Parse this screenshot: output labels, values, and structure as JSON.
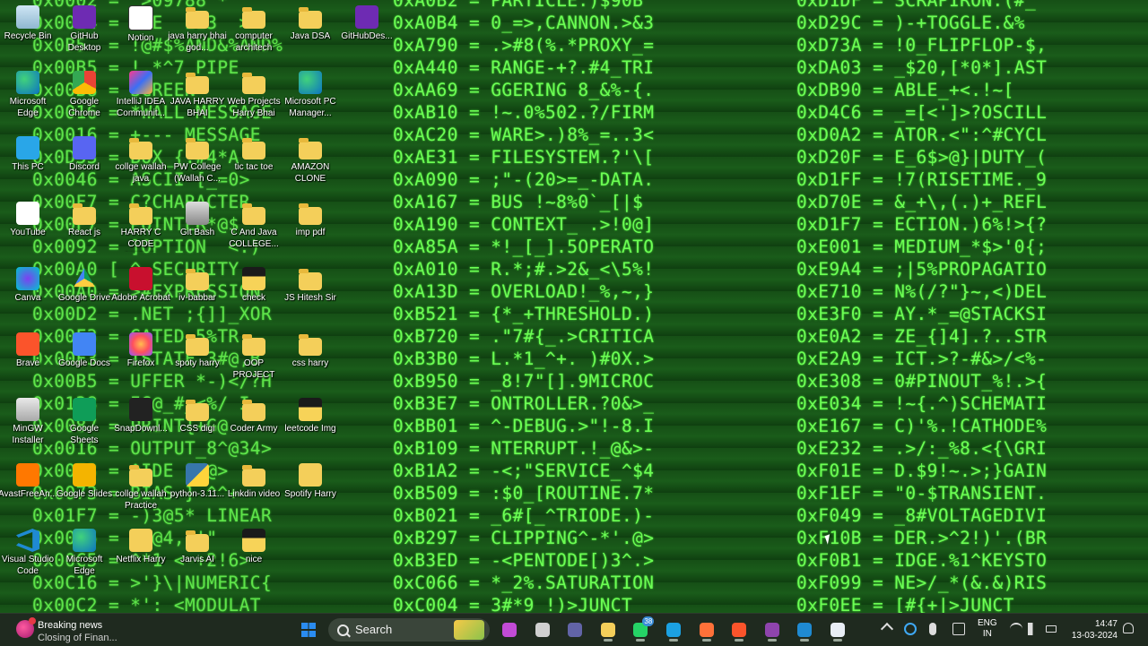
{
  "wallpaper": {
    "col_a": [
      "0x0002 = _>09788 *",
      "0x0024 = USE  LE3  >",
      "0x0B5  = !@#$%AND&%AND%",
      "0x00B5 = !.*^7 PIPE",
      "0x00B8 = SCREEN",
      "0x0016 = *WALL MESSAGE",
      "0x0016 = +--- MESSAGE",
      "0x0D33 = BOX_{.#4*A",
      "0x0046 = ASCII [_=0>",
      "0x00F7 = C?CHARACTER",
      "0x00F7 = POINTER*@$",
      "0x0092 = ]OPTION  <.)",
      "0x00A0 [ ^ SECURITY",
      "0x00A0 = >#EXPRESSION",
      "0x00D2 = .NET ;{]]_XOR",
      "0x00F3 = GATED 5%TR",
      "0x00F3 = ISTATE 3#@,B",
      "0x00B5 = UFFER *-)</?H",
      "0x0138 = IG@_#_<%/ I",
      "0x0087 = PRINT{+G@",
      "0x0016 = OUTPUT_8^@34>",
      "0x0073 = ^IDE ?/@>",
      "0x0073 = BIAS } ^^+",
      "0x01F7 = -)3@5* LINEAR",
      "0x0056 = (#@4,;'\"",
      "0x00C5 = ^*1 <-+2!6>",
      "0x0C16 = >'}\\|NUMERIC{",
      "0x00C2 = *':_<MODULAT"
    ],
    "col_b": [
      "0xA0B2 = PARTICLE.)$90B",
      "0xA0B4 = 0_=>,CANNON.>&3",
      "0xA790 = .>#8(%.*PROXY_=",
      "0xA440 = RANGE-+?.#4_TRI",
      "0xAA69 = GGERING 8_&%-{.",
      "0xAB10 = !~.0%502.?/FIRM",
      "0xAC20 = WARE>.)8%_=..3<",
      "0xAE31 = FILESYSTEM.?'\\[",
      "0xA090 = ;\"-(20>=_-DATA.",
      "0xA167 = BUS !~8%0`_[|$",
      "0xA190 = CONTEXT_ .>!0@]",
      "0xA85A = *!_[_].5OPERATO",
      "0xA010 = R.*;#.>2&_<\\5%!",
      "0xA13D = OVERLOAD!_%,~,}",
      "0xB521 = {*_+THRESHOLD.)",
      "0xB720 = .\"7#{_.>CRITICA",
      "0xB3B0 = L.*1_^+. )#0X.>",
      "0xB950 = _8!7\"[].9MICROC",
      "0xB3E7 = ONTROLLER.?0&>_",
      "0xBB01 = ^-DEBUG.>\"!-8.I",
      "0xB109 = NTERRUPT.!_@&>-",
      "0xB1A2 = -<;\"SERVICE_^$4",
      "0xB509 = :$0_[ROUTINE.7*",
      "0xB021 = _6#[_^TRIODE.)-",
      "0xB297 = CLIPPING^-*'.@>",
      "0xB3ED = -<PENTODE[)3^.>",
      "0xC066 = *_2%.SATURATION",
      "0xC004 = 3#*9 !)>JUNCT"
    ],
    "col_c": [
      "0xD1DF = SCRAPIRON.(#_'",
      "0xD29C = )-+TOGGLE.&%",
      "0xD73A = !0_FLIPFLOP-$,",
      "0xDA03 = _$20,[*0*].AST",
      "0xDB90 = ABLE_+<.!~[",
      "0xD4C6 = _=[<']>?OSCILL",
      "0xD0A2 = ATOR.<\":^#CYCL",
      "0xD20F = E_6$>@}|DUTY_(",
      "0xD1FF = !7(RISETIME._9",
      "0xD70E = &_+\\,(.)+_REFL",
      "0xD1F7 = ECTION.)6%!>{?",
      "0xE001 = MEDIUM_*$>'0{;",
      "0xE9A4 = ;|5%PROPAGATIO",
      "0xE710 = N%(/?\"}~,<)DEL",
      "0xE3F0 = AY.*_=@STACKSI",
      "0xE0A2 = ZE_{]4].?..STR",
      "0xE2A9 = ICT.>?-#&>/<%-",
      "0xE308 = 0#PINOUT_%!.>{",
      "0xE034 = !~{.^)SCHEMATI",
      "0xE167 = C)'%.!CATHODE%",
      "0xE232 = .>/:_%8.<{\\GRI",
      "0xF01E = D.$9!~.>;}GAIN",
      "0xF1EF = \"0-$TRANSIENT.",
      "0xF049 = _8#VOLTAGEDIVI",
      "0xF10B = DER.>^2!)'.(BR",
      "0xF0B1 = IDGE.%1^KEYSTO",
      "0xF099 = NE>/_*(&.&)RIS",
      "0xF0EE = [#{+|>JUNCT"
    ]
  },
  "desktop_icons": [
    {
      "label": "Recycle Bin",
      "icon": "recycle-bin-icon",
      "style": "g-bin"
    },
    {
      "label": "GitHub Desktop",
      "icon": "github-desktop-icon",
      "style": "g-github"
    },
    {
      "label": "Notion",
      "icon": "notion-icon",
      "style": "g-notion"
    },
    {
      "label": "java harry bhai god...",
      "icon": "folder-icon",
      "style": "g-folder"
    },
    {
      "label": "computer architech",
      "icon": "folder-icon",
      "style": "g-folder"
    },
    {
      "label": "Java DSA",
      "icon": "folder-icon",
      "style": "g-folder"
    },
    {
      "label": "GitHubDes...",
      "icon": "github-icon",
      "style": "g-github"
    },
    {
      "label": "Microsoft Edge",
      "icon": "edge-icon",
      "style": "g-edge"
    },
    {
      "label": "Google Chrome",
      "icon": "chrome-icon",
      "style": "g-chrome"
    },
    {
      "label": "IntelliJ IDEA Communit...",
      "icon": "intellij-icon",
      "style": "g-intellij"
    },
    {
      "label": "JAVA HARRY BHAI",
      "icon": "folder-icon",
      "style": "g-folder"
    },
    {
      "label": "Web Projects Harry Bhai",
      "icon": "folder-icon",
      "style": "g-folder"
    },
    {
      "label": "Microsoft PC Manager...",
      "icon": "pc-manager-icon",
      "style": "g-edge"
    },
    {
      "label": "This PC",
      "icon": "this-pc-icon",
      "style": "g-pc"
    },
    {
      "label": "Discord",
      "icon": "discord-icon",
      "style": "g-discord"
    },
    {
      "label": "collge wallah java",
      "icon": "folder-icon",
      "style": "g-folder"
    },
    {
      "label": "PW College (Wallah C...",
      "icon": "folder-icon",
      "style": "g-folder"
    },
    {
      "label": "tic tac toe",
      "icon": "folder-icon",
      "style": "g-folder"
    },
    {
      "label": "AMAZON CLONE",
      "icon": "folder-icon",
      "style": "g-folder"
    },
    {
      "label": "YouTube",
      "icon": "youtube-icon",
      "style": "g-youtube"
    },
    {
      "label": "React js",
      "icon": "folder-icon",
      "style": "g-folder"
    },
    {
      "label": "HARRY C CODE NOTES",
      "icon": "folder-icon",
      "style": "g-folder"
    },
    {
      "label": "Git Bash",
      "icon": "git-bash-icon",
      "style": "g-gitbash"
    },
    {
      "label": "C And Java COLLEGE...",
      "icon": "folder-icon",
      "style": "g-folder"
    },
    {
      "label": "imp pdf",
      "icon": "folder-icon",
      "style": "g-folder"
    },
    {
      "label": "Canva",
      "icon": "canva-icon",
      "style": "g-canva"
    },
    {
      "label": "Google Drive",
      "icon": "google-drive-icon",
      "style": "g-gdrive"
    },
    {
      "label": "Adobe Acrobat",
      "icon": "acrobat-icon",
      "style": "g-acrobat"
    },
    {
      "label": "iv-babbar",
      "icon": "folder-icon",
      "style": "g-folder"
    },
    {
      "label": "check",
      "icon": "image-file-icon",
      "style": "g-img"
    },
    {
      "label": "JS Hitesh Sir",
      "icon": "folder-icon",
      "style": "g-folder"
    },
    {
      "label": "Brave",
      "icon": "brave-icon",
      "style": "g-brave"
    },
    {
      "label": "Google Docs",
      "icon": "google-docs-icon",
      "style": "g-gdocs"
    },
    {
      "label": "Firefox",
      "icon": "firefox-icon",
      "style": "g-firefox"
    },
    {
      "label": "spoty harry",
      "icon": "folder-icon",
      "style": "g-folder"
    },
    {
      "label": "OOP PROJECT",
      "icon": "folder-icon",
      "style": "g-folder"
    },
    {
      "label": "css harry",
      "icon": "folder-icon",
      "style": "g-folder"
    },
    {
      "label": "MinGW Installer",
      "icon": "mingw-icon",
      "style": "g-mingw"
    },
    {
      "label": "Google Sheets",
      "icon": "google-sheets-icon",
      "style": "g-gsheets"
    },
    {
      "label": "SnapDownl...",
      "icon": "snapdownloader-icon",
      "style": "g-snap"
    },
    {
      "label": "CSS digi",
      "icon": "folder-icon",
      "style": "g-folder"
    },
    {
      "label": "Coder Army",
      "icon": "folder-icon",
      "style": "g-folder"
    },
    {
      "label": "leetcode Img",
      "icon": "image-file-icon",
      "style": "g-img"
    },
    {
      "label": "AvastFreeAn...",
      "icon": "avast-icon",
      "style": "g-avast"
    },
    {
      "label": "Google Slides",
      "icon": "google-slides-icon",
      "style": "g-gslides"
    },
    {
      "label": "collge wallah Practice",
      "icon": "folder-icon",
      "style": "g-folder"
    },
    {
      "label": "python-3.11...",
      "icon": "python-icon",
      "style": "g-python"
    },
    {
      "label": "Linkdin video",
      "icon": "folder-icon",
      "style": "g-folder"
    },
    {
      "label": "Spotify Harry",
      "icon": "folder-icon",
      "style": "g-spotify"
    },
    {
      "label": "Visual Studio Code",
      "icon": "vscode-icon",
      "style": "g-vscode"
    },
    {
      "label": "Microsoft Edge",
      "icon": "edge-icon",
      "style": "g-edge"
    },
    {
      "label": "Netflix Harry",
      "icon": "folder-icon",
      "style": "g-netflix"
    },
    {
      "label": "Jarvis AI",
      "icon": "folder-icon",
      "style": "g-folder"
    },
    {
      "label": "nice",
      "icon": "image-file-icon",
      "style": "g-img"
    }
  ],
  "taskbar": {
    "news_title": "Breaking news",
    "news_subtitle": "Closing of Finan...",
    "search_label": "Search",
    "pinned": [
      {
        "icon": "copilot-icon",
        "color": "#c24bd6"
      },
      {
        "icon": "task-view-icon",
        "color": "#d0d0d0"
      },
      {
        "icon": "teams-icon",
        "color": "#6264a7"
      },
      {
        "icon": "file-explorer-icon",
        "color": "#f4cf5a"
      },
      {
        "icon": "whatsapp-icon",
        "color": "#25d366",
        "badge": "38"
      },
      {
        "icon": "edge-icon",
        "color": "#1ba1e2"
      },
      {
        "icon": "firefox-icon",
        "color": "#ff7139"
      },
      {
        "icon": "brave-icon",
        "color": "#fb542b"
      },
      {
        "icon": "github-desktop-icon",
        "color": "#8e44ad"
      },
      {
        "icon": "vscode-icon",
        "color": "#1f8ad2"
      },
      {
        "icon": "notepad-icon",
        "color": "#e8eef5"
      }
    ],
    "language_line1": "ENG",
    "language_line2": "IN",
    "time": "14:47",
    "date": "13-03-2024"
  }
}
